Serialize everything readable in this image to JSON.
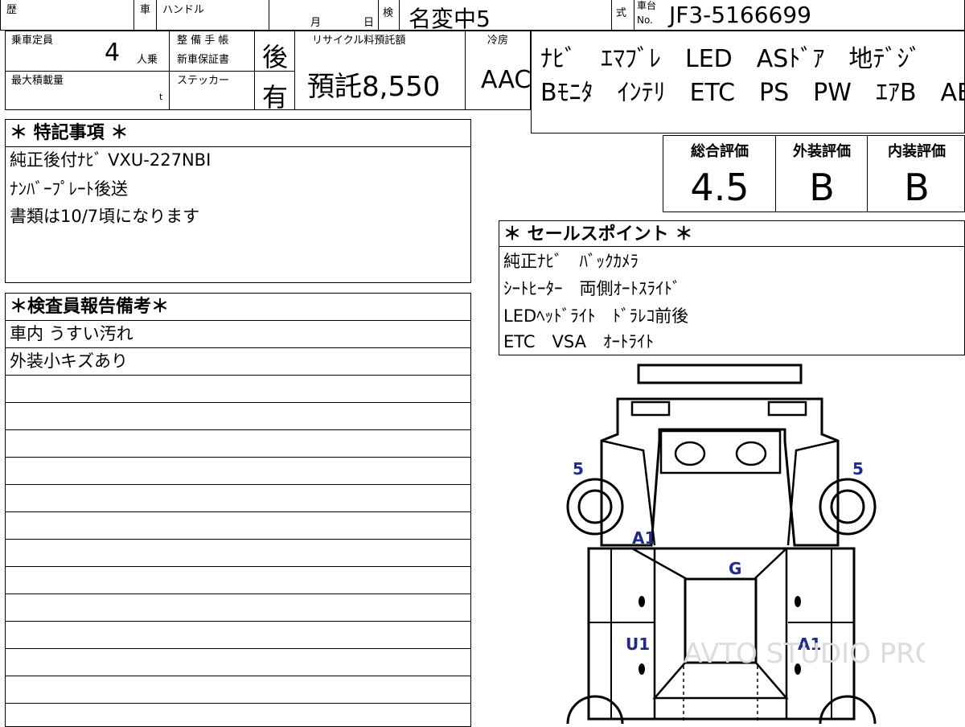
{
  "header": {
    "history_label": "歴",
    "car_label": "車",
    "handle_label": "ハンドル",
    "month_label": "月",
    "day_label": "日",
    "inspection_label": "検",
    "inspection_value": "名変中5",
    "type_label": "式",
    "frame_label_top": "車台",
    "frame_label_bottom": "No.",
    "frame_value": "JF3-5166699"
  },
  "specs": {
    "capacity_label": "乗車定員",
    "capacity_value": "4",
    "capacity_unit": "人乗",
    "maintenance_label": "整 備 手 帳",
    "warranty_label": "新車保証書",
    "maintenance_value": "後",
    "load_label": "最大積載量",
    "load_unit": "t",
    "sticker_label": "ステッカー",
    "sticker_value": "有",
    "recycle_label": "リサイクル料預託額",
    "recycle_value": "預託8,550",
    "ac_label": "冷房",
    "ac_value": "AAC"
  },
  "equipment": {
    "line1": "ﾅﾋﾞ　ｴﾏﾌﾞﾚ　LED　ASﾄﾞｱ　地ﾃﾞｼﾞ",
    "line2": "Bﾓﾆﾀ　ｲﾝﾃﾘ　ETC　PS　PW　ｴｱB　ABS"
  },
  "notes": {
    "title": "＊ 特記事項 ＊",
    "lines": [
      "純正後付ﾅﾋﾞ VXU-227NBI",
      "ﾅﾝﾊﾞｰﾌﾟﾚｰﾄ後送",
      "書類は10/7頃になります"
    ]
  },
  "grades": {
    "overall_label": "総合評価",
    "overall_value": "4.5",
    "exterior_label": "外装評価",
    "exterior_value": "B",
    "interior_label": "内装評価",
    "interior_value": "B"
  },
  "sales_points": {
    "title": "＊ セールスポイント ＊",
    "lines": [
      "純正ﾅﾋﾞ　ﾊﾞｯｸｶﾒﾗ",
      "ｼｰﾄﾋｰﾀｰ　両側ｵｰﾄｽﾗｲﾄﾞ",
      "LEDﾍｯﾄﾞﾗｲﾄ　ﾄﾞﾗﾚｺ前後",
      "ETC　VSA　ｵｰﾄﾗｲﾄ"
    ]
  },
  "inspector": {
    "title": "＊検査員報告備考＊",
    "lines": [
      "車内 うすい汚れ",
      "外装小キズあり"
    ]
  },
  "damage_marks": {
    "front_left_tire": "5",
    "front_right_tire": "5",
    "front_left_fender": "A1",
    "windshield": "G",
    "left_door": "U1",
    "right_door": "A1"
  },
  "watermark": "AVTO STUDIO PRO"
}
